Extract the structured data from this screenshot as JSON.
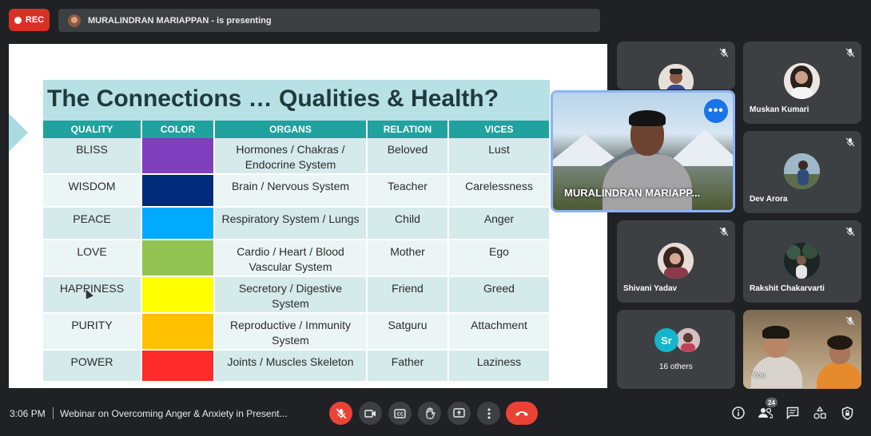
{
  "recording": {
    "label": "REC"
  },
  "presenting_bar": {
    "text": "MURALINDRAN MARIAPPAN - is presenting"
  },
  "slide": {
    "title": "The Connections … Qualities & Health?",
    "columns": [
      "QUALITY",
      "COLOR",
      "ORGANS",
      "RELATION",
      "VICES"
    ],
    "rows": [
      {
        "quality": "BLISS",
        "color": "#7f3fbf",
        "organs": [
          "Hormones / Chakras /",
          "Endocrine System"
        ],
        "relation": "Beloved",
        "vice": "Lust"
      },
      {
        "quality": "WISDOM",
        "color": "#002b7a",
        "organs": [
          "Brain / Nervous System"
        ],
        "relation": "Teacher",
        "vice": "Carelessness"
      },
      {
        "quality": "PEACE",
        "color": "#00aaff",
        "organs": [
          "Respiratory System / Lungs"
        ],
        "relation": "Child",
        "vice": "Anger"
      },
      {
        "quality": "LOVE",
        "color": "#92c353",
        "organs": [
          "Cardio / Heart / Blood",
          "Vascular System"
        ],
        "relation": "Mother",
        "vice": "Ego"
      },
      {
        "quality": "HAPPINESS",
        "color": "#ffff00",
        "organs": [
          "Secretory / Digestive",
          "System"
        ],
        "relation": "Friend",
        "vice": "Greed"
      },
      {
        "quality": "PURITY",
        "color": "#ffc000",
        "organs": [
          "Reproductive / Immunity",
          "System"
        ],
        "relation": "Satguru",
        "vice": "Attachment"
      },
      {
        "quality": "POWER",
        "color": "#ff2a2a",
        "organs": [
          "Joints / Muscles Skeleton"
        ],
        "relation": "Father",
        "vice": "Laziness"
      }
    ]
  },
  "presenter": {
    "name": "MURALINDRAN MARIAPP...",
    "more_icon": "more-horizontal-icon"
  },
  "participants": [
    {
      "name": "",
      "avatar_color": "#c9c2b8",
      "muted": true
    },
    {
      "name": "Muskan Kumari",
      "avatar_color": "#d9c7c0",
      "muted": true
    },
    {
      "name": "Dev Arora",
      "avatar_color": "#7a8f9c",
      "muted": true
    },
    {
      "name": "Shivani Yadav",
      "avatar_color": "#b58a7a",
      "muted": true
    },
    {
      "name": "Rakshit Chakarvarti",
      "avatar_color": "#2d3a3a",
      "muted": true
    }
  ],
  "others": {
    "initials": "Sr",
    "label": "16 others",
    "initials_color": "#12b5cb"
  },
  "self_tile": {
    "label": "You"
  },
  "bottom_bar": {
    "time": "3:06 PM",
    "meeting_title": "Webinar on Overcoming Anger & Anxiety in Present...",
    "participant_count": "24"
  }
}
